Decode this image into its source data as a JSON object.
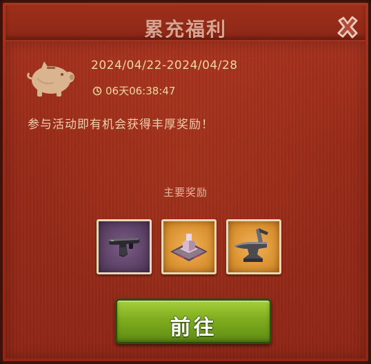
{
  "dialog": {
    "title": "累充福利",
    "date_range": "2024/04/22-2024/04/28",
    "countdown": "06天06:38:47",
    "description": "参与活动即有机会获得丰厚奖励！",
    "rewards_label": "主要奖励",
    "rewards": [
      {
        "icon": "pistol-icon",
        "rarity_color": "#5a3f63"
      },
      {
        "icon": "building-crate-icon",
        "rarity_color": "#d88f2e"
      },
      {
        "icon": "anvil-icon",
        "rarity_color": "#d88f2e"
      }
    ],
    "go_button_label": "前往"
  },
  "colors": {
    "panel_red": "#982a18",
    "title_text": "#d9a48f",
    "info_text": "#f2d9a0",
    "button_green": "#7fac1f"
  }
}
